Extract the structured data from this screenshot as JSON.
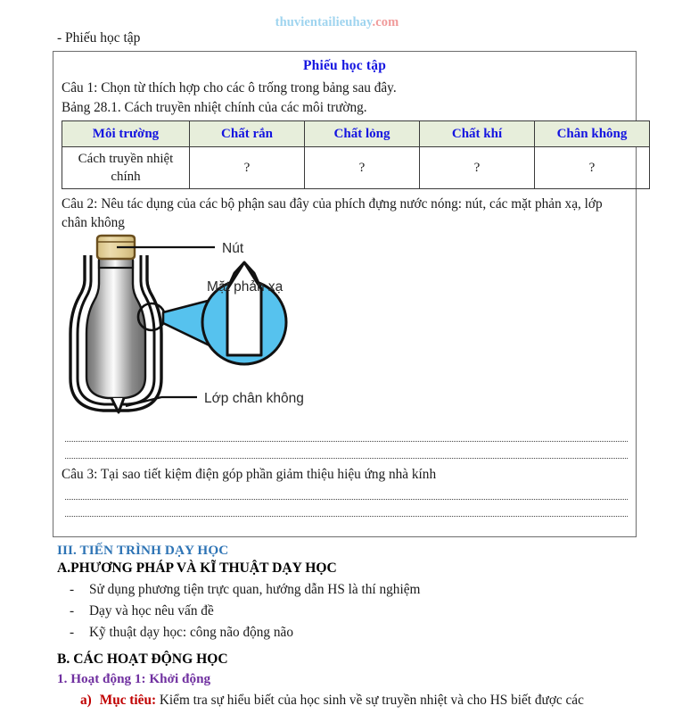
{
  "watermark": {
    "name": "thuvientailieuhay",
    "tld": ".com",
    "name_color": "#9fd4ef",
    "tld_color": "#f09a9a"
  },
  "pre_box_line": "- Phiếu học tập",
  "worksheet": {
    "title": "Phiếu học tập",
    "title_color": "#1414e0",
    "question1": "Câu 1: Chọn từ thích hợp cho các ô trống trong bảng sau đây.",
    "table_caption": "Bảng 28.1. Cách truyền nhiệt chính của các môi trường.",
    "table": {
      "header_bg": "#e7eedb",
      "header_color": "#1414e0",
      "headers": [
        "Môi trường",
        "Chất rắn",
        "Chất lỏng",
        "Chất khí",
        "Chân không"
      ],
      "rows": [
        {
          "label": "Cách truyền nhiệt chính",
          "cells": [
            "?",
            "?",
            "?",
            "?"
          ]
        }
      ]
    },
    "question2": "Câu 2: Nêu tác dụng của các bộ phận sau đây của phích đựng nước nóng: nút, các mặt phản xạ, lớp chân không",
    "figure": {
      "label_cap": "Nút",
      "label_reflective": "Mặt phản xạ",
      "label_vacuum": "Lớp chân không",
      "cap_color": "#e3cf96",
      "magnifier_color": "#56c2ee"
    },
    "question3": "Câu 3: Tại sao tiết kiệm điện góp phần giảm thiệu hiệu ứng nhà kính"
  },
  "sections": {
    "heading_iii": "III. TIẾN TRÌNH DẠY HỌC",
    "heading_iii_color": "#2e74b5",
    "heading_a": "A.PHƯƠNG PHÁP VÀ KĨ THUẬT DẠY HỌC",
    "bullets": [
      "Sử dụng phương tiện trực quan, hướng dẫn HS là thí nghiệm",
      "Dạy và học nêu vấn đề",
      "Kỹ thuật dạy học: công não động não"
    ],
    "heading_b": "B. CÁC HOẠT ĐỘNG HỌC",
    "activity1": "1. Hoạt động 1: Khởi động",
    "activity1_color": "#7030a0",
    "item_a_marker": "a)",
    "item_a_label": "Mục tiêu:",
    "item_a_label_color": "#c00000",
    "item_a_text": "Kiểm tra sự hiểu biết của học sinh về sự truyền nhiệt và cho HS biết được các"
  }
}
